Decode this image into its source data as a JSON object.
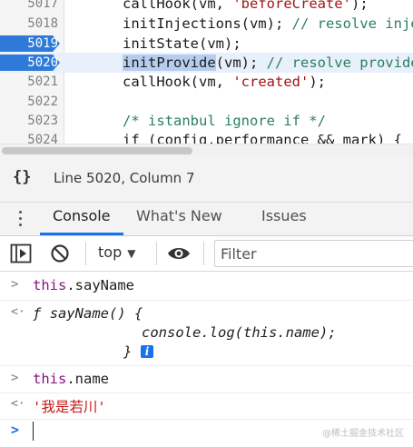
{
  "editor": {
    "lines": [
      {
        "num": "5017",
        "parts": [
          {
            "t": "callHook(vm, "
          },
          {
            "t": "'beforeCreate'",
            "c": "str"
          },
          {
            "t": ");"
          }
        ]
      },
      {
        "num": "5018",
        "parts": [
          {
            "t": "initInjections(vm); "
          },
          {
            "t": "// resolve injections before data/props",
            "c": "com"
          }
        ]
      },
      {
        "num": "5019",
        "parts": [
          {
            "t": "initState(vm);"
          }
        ]
      },
      {
        "num": "5020",
        "parts": [
          {
            "t": "initProvide",
            "c": "sel"
          },
          {
            "t": "(vm); "
          },
          {
            "t": "// resolve provide after data/props",
            "c": "com"
          }
        ]
      },
      {
        "num": "5021",
        "parts": [
          {
            "t": "callHook(vm, "
          },
          {
            "t": "'created'",
            "c": "str"
          },
          {
            "t": ");"
          }
        ]
      },
      {
        "num": "5022",
        "parts": []
      },
      {
        "num": "5023",
        "parts": [
          {
            "t": "/* istanbul ignore if */",
            "c": "com"
          }
        ]
      },
      {
        "num": "5024",
        "parts": [
          {
            "t": "if (config.performance && mark) {"
          }
        ]
      }
    ]
  },
  "status": {
    "brace": "{}",
    "position": "Line 5020, Column 7"
  },
  "tabs": [
    {
      "label": "Console",
      "active": true
    },
    {
      "label": "What's New",
      "active": false
    },
    {
      "label": "Issues",
      "active": false
    }
  ],
  "toolbar": {
    "context": "top",
    "filter_placeholder": "Filter"
  },
  "console": {
    "entry1": {
      "prefix": "this",
      "rest": ".sayName"
    },
    "entry2": {
      "line1_f": "ƒ",
      "line1_sig": "sayName() {",
      "line2": "console.log(this.name);",
      "line3": "}"
    },
    "entry3": {
      "prefix": "this",
      "rest": ".name"
    },
    "entry4": "'我是若川'"
  },
  "watermark": "@稀土掘金技术社区",
  "colors": {
    "breakpoint": "#2f7ad9",
    "accent": "#1a73e8",
    "current_line": "#e8f0fb"
  }
}
